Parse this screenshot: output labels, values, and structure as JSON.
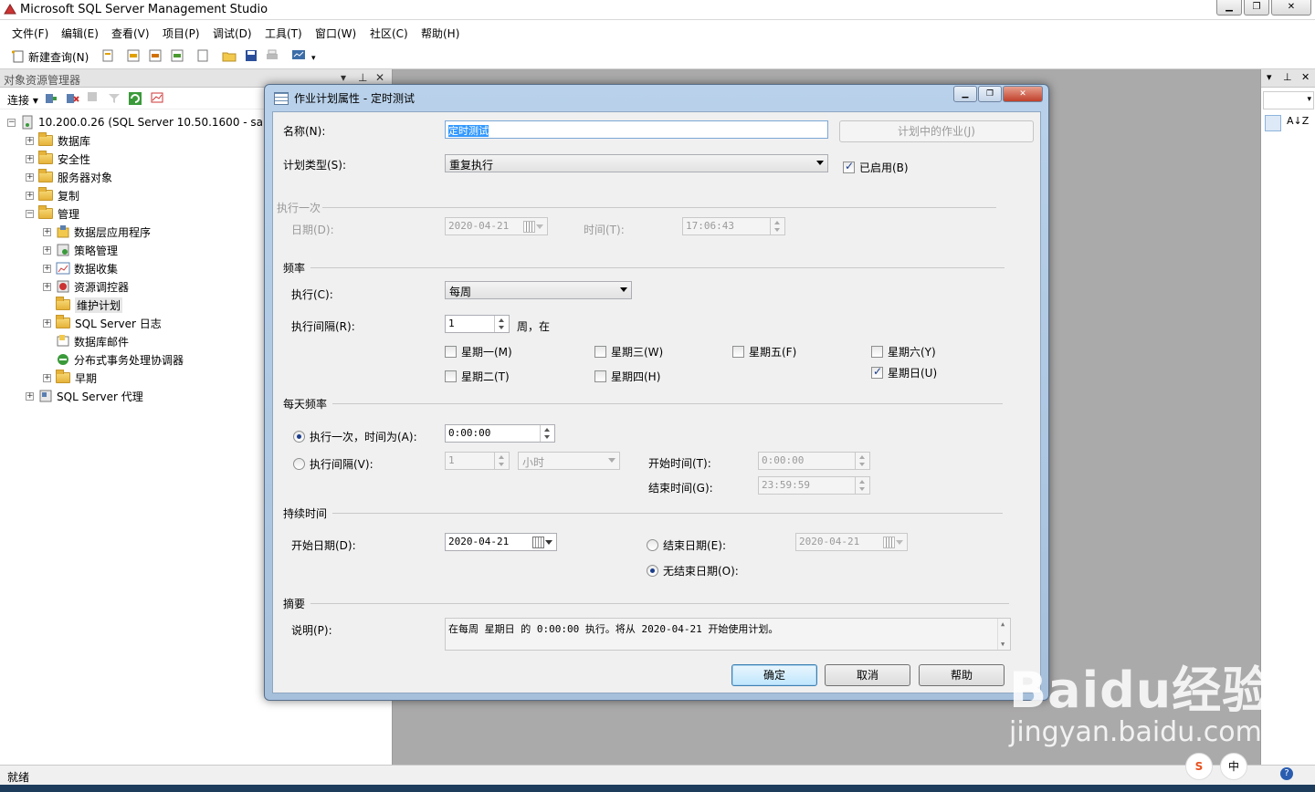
{
  "app": {
    "title": "Microsoft SQL Server Management Studio"
  },
  "menu": [
    "文件(F)",
    "编辑(E)",
    "查看(V)",
    "项目(P)",
    "调试(D)",
    "工具(T)",
    "窗口(W)",
    "社区(C)",
    "帮助(H)"
  ],
  "toolbar": {
    "new_query": "新建查询(N)"
  },
  "explorer": {
    "title": "对象资源管理器",
    "connect": "连接",
    "server": "10.200.0.26 (SQL Server 10.50.1600 - sa)",
    "nodes": [
      "数据库",
      "安全性",
      "服务器对象",
      "复制",
      "管理",
      "数据层应用程序",
      "策略管理",
      "数据收集",
      "资源调控器",
      "维护计划",
      "SQL Server 日志",
      "数据库邮件",
      "分布式事务处理协调器",
      "早期",
      "SQL Server 代理"
    ]
  },
  "status": {
    "text": "就绪"
  },
  "dialog": {
    "title": "作业计划属性 - 定时测试",
    "name_label": "名称(N):",
    "name_value": "定时测试",
    "jobs_button": "计划中的作业(J)",
    "type_label": "计划类型(S):",
    "type_value": "重复执行",
    "enabled_label": "已启用(B)",
    "once": {
      "section": "执行一次",
      "date_label": "日期(D):",
      "date_value": "2020-04-21",
      "time_label": "时间(T):",
      "time_value": "17:06:43"
    },
    "freq": {
      "section": "频率",
      "exec_label": "执行(C):",
      "exec_value": "每周",
      "interval_label": "执行间隔(R):",
      "interval_value": "1",
      "interval_unit": "周，在",
      "days": {
        "mon": "星期一(M)",
        "tue": "星期二(T)",
        "wed": "星期三(W)",
        "thu": "星期四(H)",
        "fri": "星期五(F)",
        "sat": "星期六(Y)",
        "sun": "星期日(U)"
      }
    },
    "daily": {
      "section": "每天频率",
      "once_label": "执行一次，时间为(A):",
      "once_value": "0:00:00",
      "every_label": "执行间隔(V):",
      "every_value": "1",
      "every_unit": "小时",
      "start_label": "开始时间(T):",
      "start_value": "0:00:00",
      "end_label": "结束时间(G):",
      "end_value": "23:59:59"
    },
    "duration": {
      "section": "持续时间",
      "start_label": "开始日期(D):",
      "start_value": "2020-04-21",
      "end_label": "结束日期(E):",
      "end_value": "2020-04-21",
      "noend_label": "无结束日期(O):"
    },
    "summary": {
      "section": "摘要",
      "desc_label": "说明(P):",
      "desc_value": "在每周 星期日 的 0:00:00 执行。将从 2020-04-21 开始使用计划。"
    },
    "buttons": {
      "ok": "确定",
      "cancel": "取消",
      "help": "帮助"
    }
  },
  "watermark": {
    "brand": "Baidu经验",
    "url": "jingyan.baidu.com"
  },
  "colors": {
    "selection": "#3399ff",
    "dialog_frame": "#b9d1ea",
    "check": "#1a3c8c"
  }
}
